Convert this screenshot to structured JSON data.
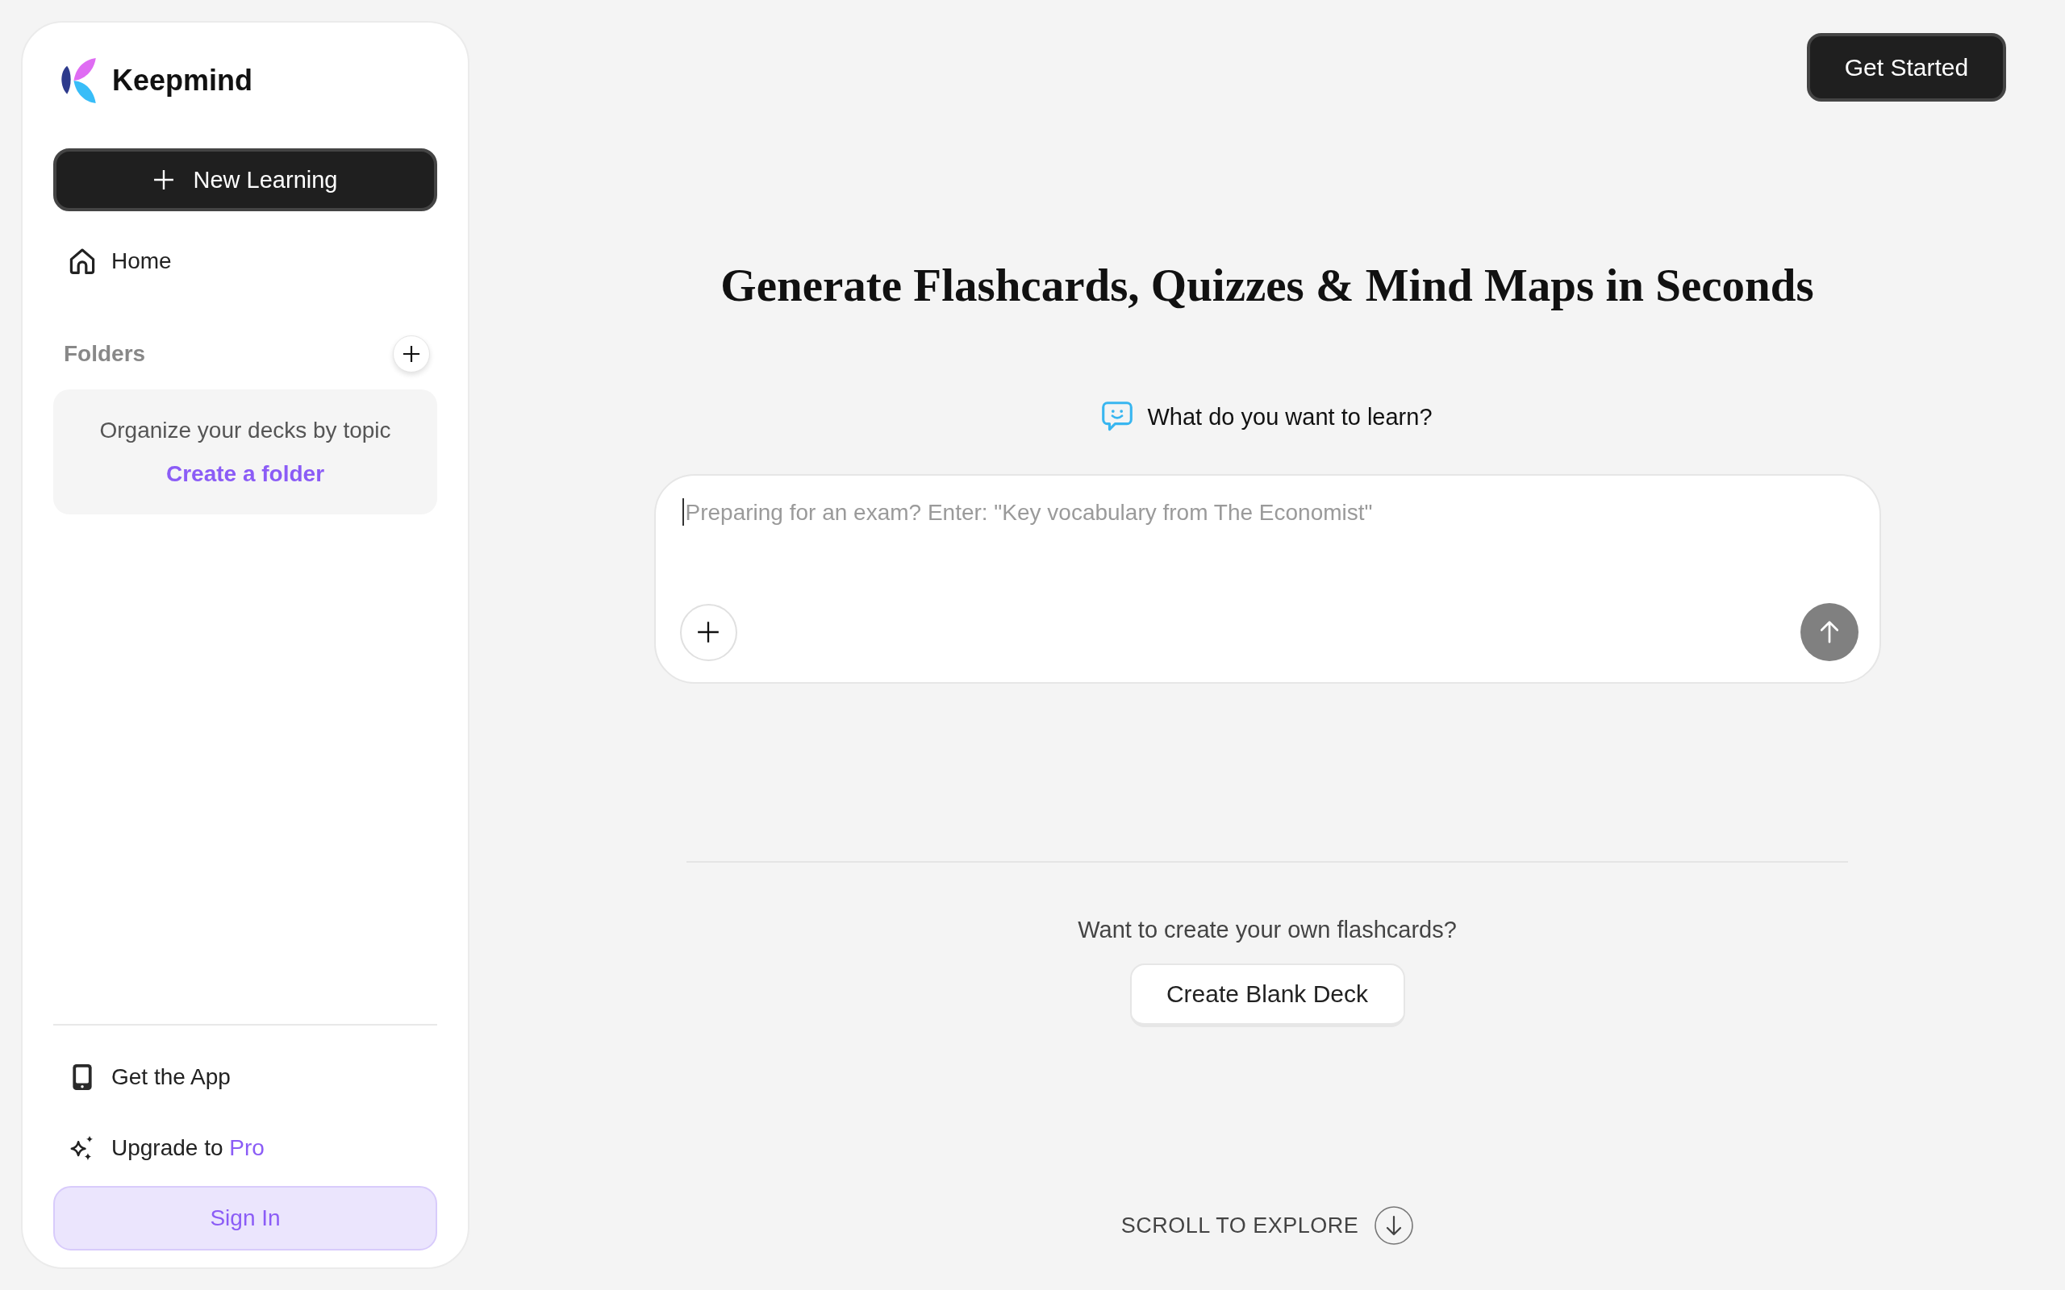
{
  "sidebar": {
    "brand": "Keepmind",
    "new_button": "New Learning",
    "home_link": "Home",
    "folders": {
      "title": "Folders",
      "empty_text": "Organize your decks by topic",
      "create_link": "Create a folder"
    },
    "get_app_link": "Get the App",
    "upgrade_link": {
      "label": "Upgrade to",
      "highlight": "Pro"
    },
    "sign_in_button": "Sign In"
  },
  "header": {
    "get_started_button": "Get Started"
  },
  "hero": {
    "title": "Generate Flashcards, Quizzes & Mind Maps in Seconds",
    "prompt_label": "What do you want to learn?",
    "input": {
      "placeholder": "Preparing for an exam? Enter: \"Key vocabulary from The Economist\"",
      "focused": true
    }
  },
  "manual": {
    "question": "Want to create your own flashcards?",
    "button": "Create Blank Deck"
  },
  "scroll_hint": "SCROLL TO EXPLORE"
}
